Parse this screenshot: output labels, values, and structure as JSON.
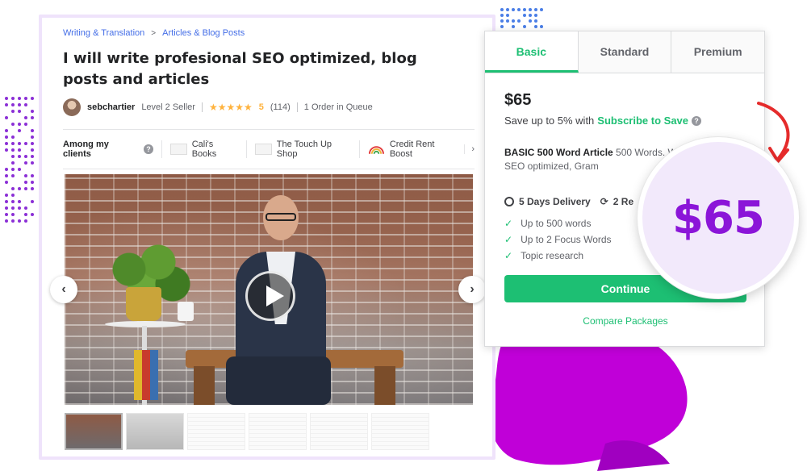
{
  "breadcrumb": {
    "category": "Writing & Translation",
    "subcategory": "Articles & Blog Posts"
  },
  "gig": {
    "title": "I will write profesional SEO optimized, blog posts and articles",
    "seller_name": "sebchartier",
    "seller_level": "Level 2 Seller",
    "stars": "★★★★★",
    "rating": "5",
    "review_count": "(114)",
    "queue": "1 Order in Queue"
  },
  "clients": {
    "label": "Among my clients",
    "items": [
      {
        "name": "Cali's Books"
      },
      {
        "name": "The Touch Up Shop"
      },
      {
        "name": "Credit Rent Boost"
      }
    ],
    "next_icon": "chevron-right-icon"
  },
  "media": {
    "prev_icon": "chevron-left-icon",
    "next_icon": "chevron-right-icon",
    "play_icon": "play-icon"
  },
  "pricing": {
    "tabs": [
      "Basic",
      "Standard",
      "Premium"
    ],
    "active_tab": "Basic",
    "price": "$65",
    "save_prefix": "Save up to 5% with",
    "save_link": "Subscribe to Save",
    "package_name": "BASIC 500 Word Article",
    "package_desc": "500 Words. W original and SEO optimized, Gram",
    "delivery": "5 Days Delivery",
    "revisions": "2 Re",
    "features": [
      "Up to 500 words",
      "Up to 2 Focus Words",
      "Topic research"
    ],
    "continue_label": "Continue",
    "compare_label": "Compare Packages"
  },
  "callout": {
    "price": "$65"
  },
  "colors": {
    "accent_green": "#1dbf73",
    "callout_purple": "#8b15d8",
    "link_blue": "#446ee7",
    "star": "#ffb33e",
    "arrow_red": "#e52b2b"
  }
}
